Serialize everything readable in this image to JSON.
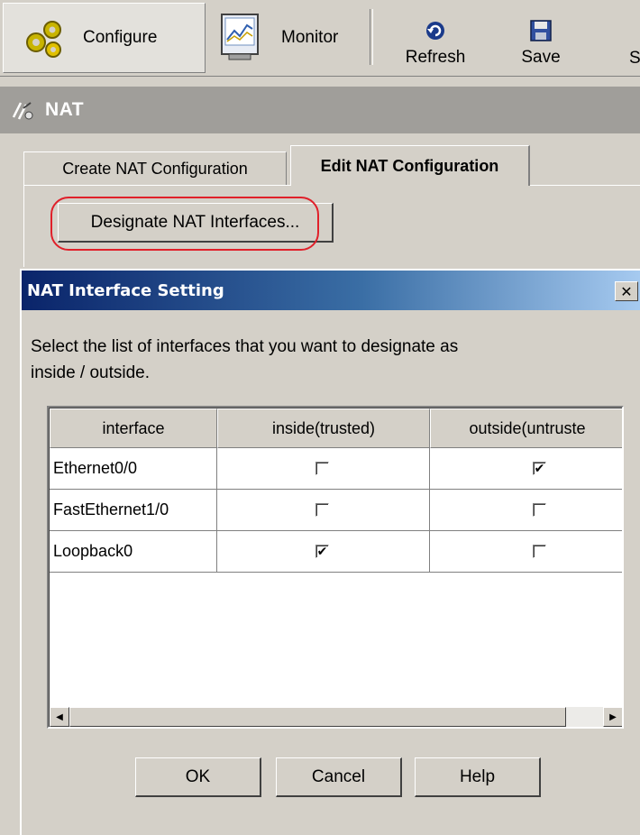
{
  "toolbar": {
    "configure_label": "Configure",
    "monitor_label": "Monitor",
    "refresh_label": "Refresh",
    "save_label": "Save",
    "cut_label": "S"
  },
  "section": {
    "title": "NAT"
  },
  "tabs": [
    {
      "label": "Create NAT Configuration",
      "active": false
    },
    {
      "label": "Edit NAT Configuration",
      "active": true
    }
  ],
  "designate_button_label": "Designate NAT Interfaces...",
  "dialog": {
    "title": "NAT Interface Setting",
    "close_label": "✕",
    "instruction_line1": "Select the list of interfaces that you want to designate as",
    "instruction_line2": "inside / outside.",
    "columns": [
      "interface",
      "inside(trusted)",
      "outside(untruste"
    ],
    "rows": [
      {
        "interface": "Ethernet0/0",
        "inside": false,
        "outside": true
      },
      {
        "interface": "FastEthernet1/0",
        "inside": false,
        "outside": false
      },
      {
        "interface": "Loopback0",
        "inside": true,
        "outside": false
      }
    ],
    "scroll": {
      "position": 0.0,
      "visible_fraction": 0.93
    },
    "buttons": {
      "ok": "OK",
      "cancel": "Cancel",
      "help": "Help"
    }
  }
}
